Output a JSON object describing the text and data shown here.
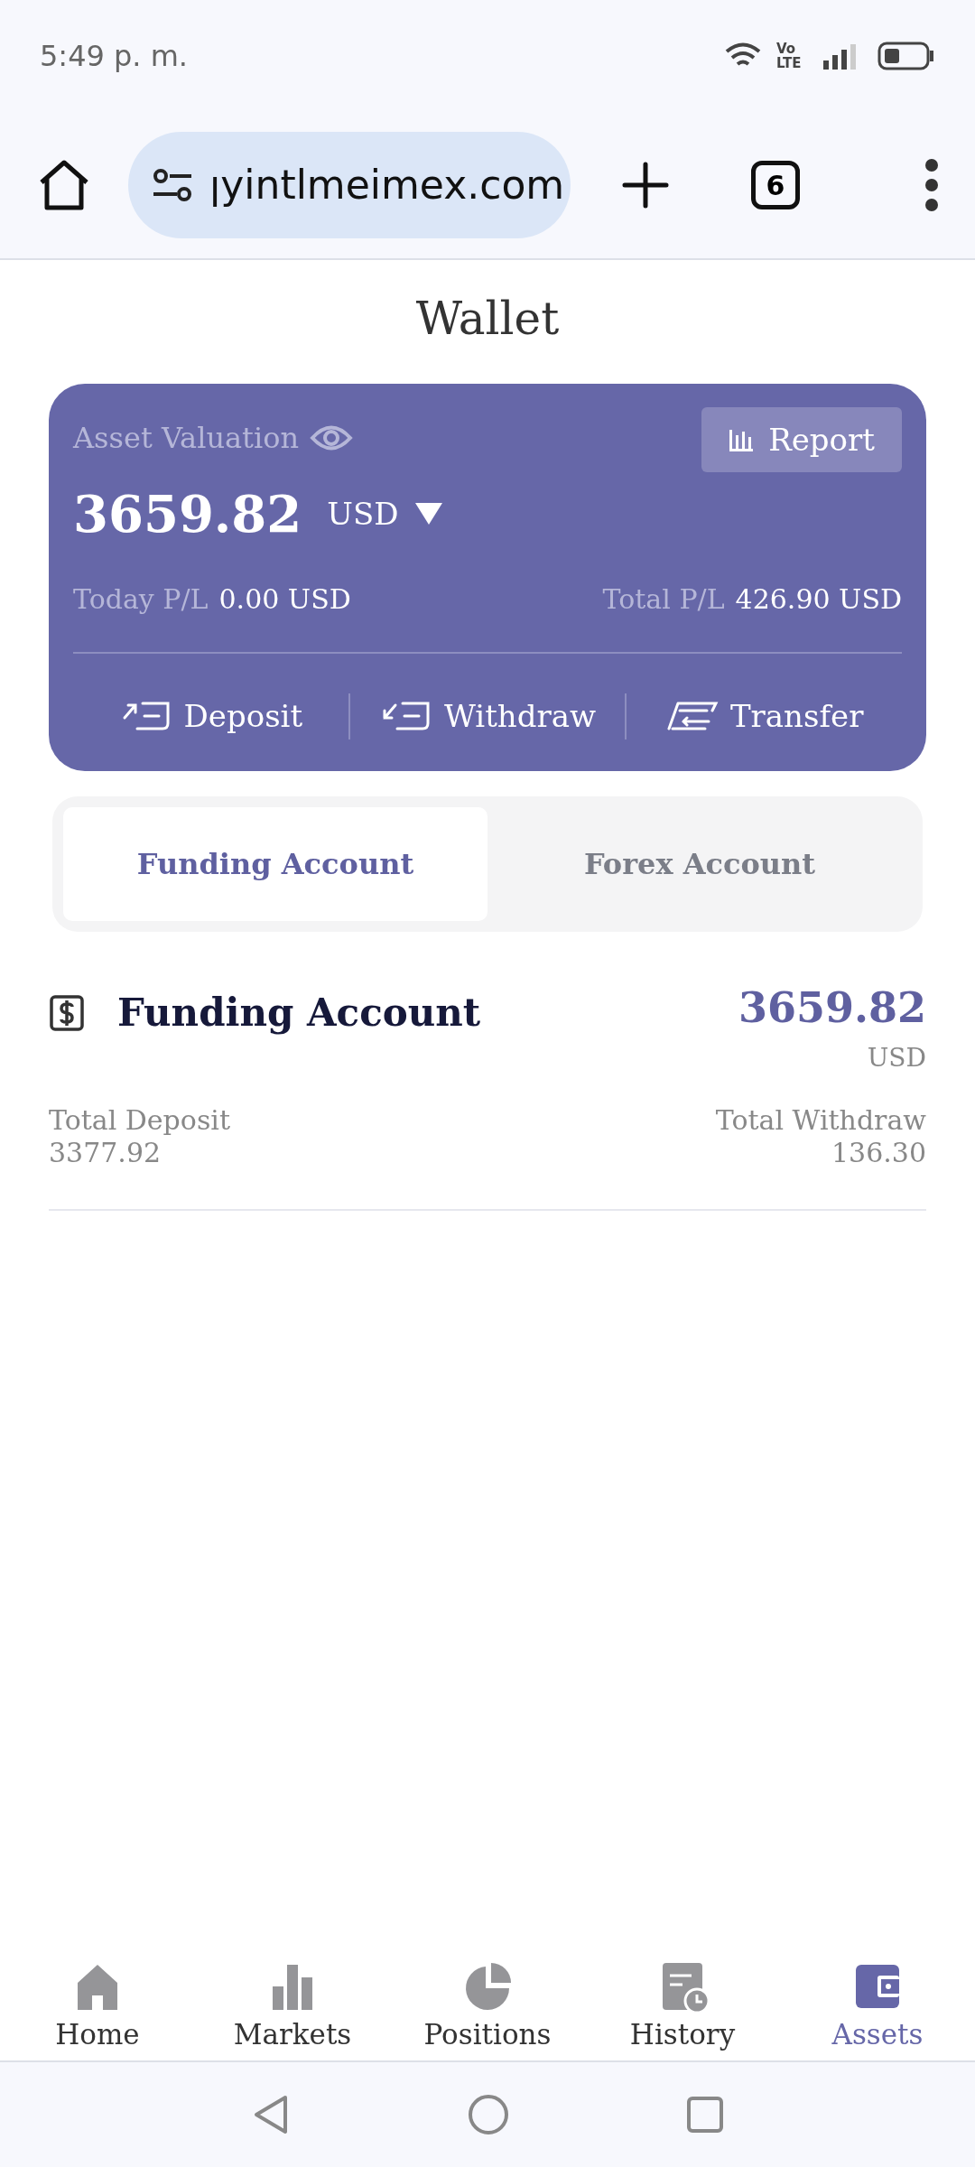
{
  "status_bar": {
    "time": "5:49 p. m.",
    "network": "Vo LTE"
  },
  "browser": {
    "url": "ꞁyintlmeimex.com",
    "tab_count": "6"
  },
  "page": {
    "title": "Wallet"
  },
  "card": {
    "label": "Asset Valuation",
    "report": "Report",
    "amount": "3659.82",
    "currency": "USD",
    "today_label": "Today P/L",
    "today_value": "0.00 USD",
    "total_label": "Total P/L",
    "total_value": "426.90 USD",
    "actions": [
      {
        "kind": "deposit",
        "label": "Deposit"
      },
      {
        "kind": "withdraw",
        "label": "Withdraw"
      },
      {
        "kind": "transfer",
        "label": "Transfer"
      }
    ]
  },
  "tabs": [
    {
      "label": "Funding Account",
      "selected": true
    },
    {
      "label": "Forex Account",
      "selected": false
    }
  ],
  "account": {
    "title": "Funding Account",
    "balance": "3659.82",
    "currency": "USD",
    "deposit_label": "Total Deposit",
    "deposit_value": "3377.92",
    "withdraw_label": "Total Withdraw",
    "withdraw_value": "136.30"
  },
  "nav": [
    {
      "kind": "home",
      "label": "Home",
      "selected": false
    },
    {
      "kind": "markets",
      "label": "Markets",
      "selected": false
    },
    {
      "kind": "positions",
      "label": "Positions",
      "selected": false
    },
    {
      "kind": "history",
      "label": "History",
      "selected": false
    },
    {
      "kind": "assets",
      "label": "Assets",
      "selected": true
    }
  ]
}
